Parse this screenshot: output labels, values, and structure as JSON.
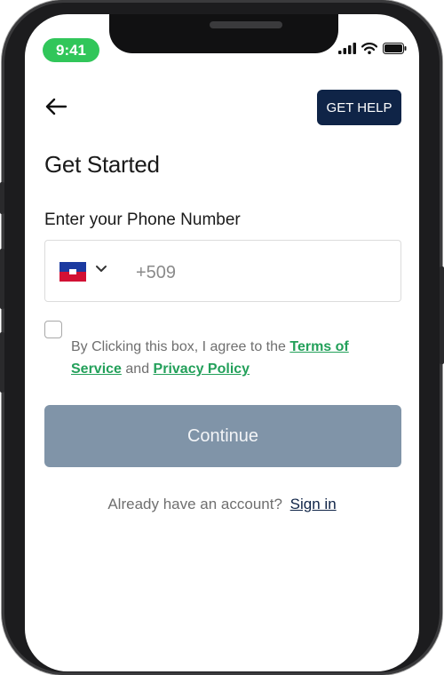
{
  "status_bar": {
    "time": "9:41",
    "time_pill_color": "#31c65a"
  },
  "header": {
    "back_icon": "arrow-left-icon",
    "help_label": "GET HELP",
    "help_color": "#0f2447"
  },
  "title": "Get Started",
  "phone": {
    "label": "Enter your Phone Number",
    "country_flag": "haiti-flag-icon",
    "placeholder": "+509"
  },
  "terms": {
    "checked": false,
    "prefix": "By Clicking this box, I agree to the",
    "terms_link": "Terms of Service",
    "joiner": "and",
    "privacy_link": "Privacy Policy",
    "link_color": "#23a05a"
  },
  "continue_label": "Continue",
  "signin": {
    "prompt": "Already have an account?",
    "link": "Sign in"
  }
}
